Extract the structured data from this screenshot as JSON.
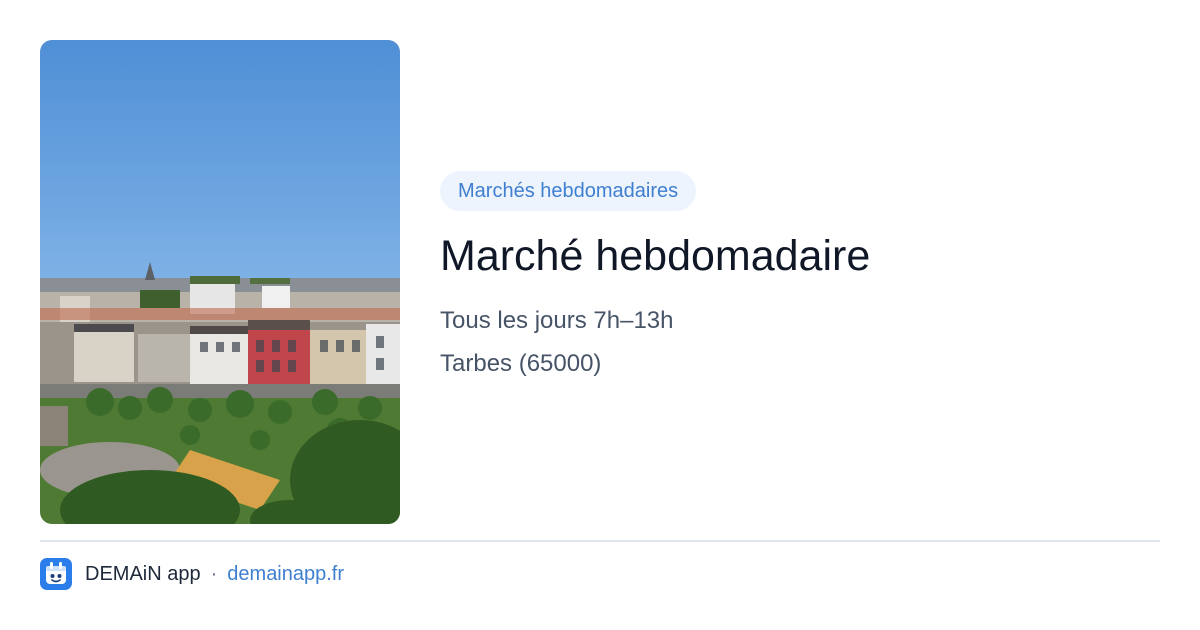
{
  "photo": {
    "subject": "city-view-photo"
  },
  "event": {
    "category": "Marchés hebdomadaires",
    "title": "Marché hebdomadaire",
    "schedule": "Tous les jours 7h–13h",
    "location": "Tarbes (65000)"
  },
  "footer": {
    "app_name": "DEMAiN app",
    "separator": "·",
    "site": "demainapp.fr",
    "icon": "demain-app-icon"
  },
  "colors": {
    "accent": "#3f7fd0",
    "tag_background": "#eef4fd",
    "title": "#101828",
    "body_text": "#475467",
    "divider": "#dfe6ee"
  }
}
